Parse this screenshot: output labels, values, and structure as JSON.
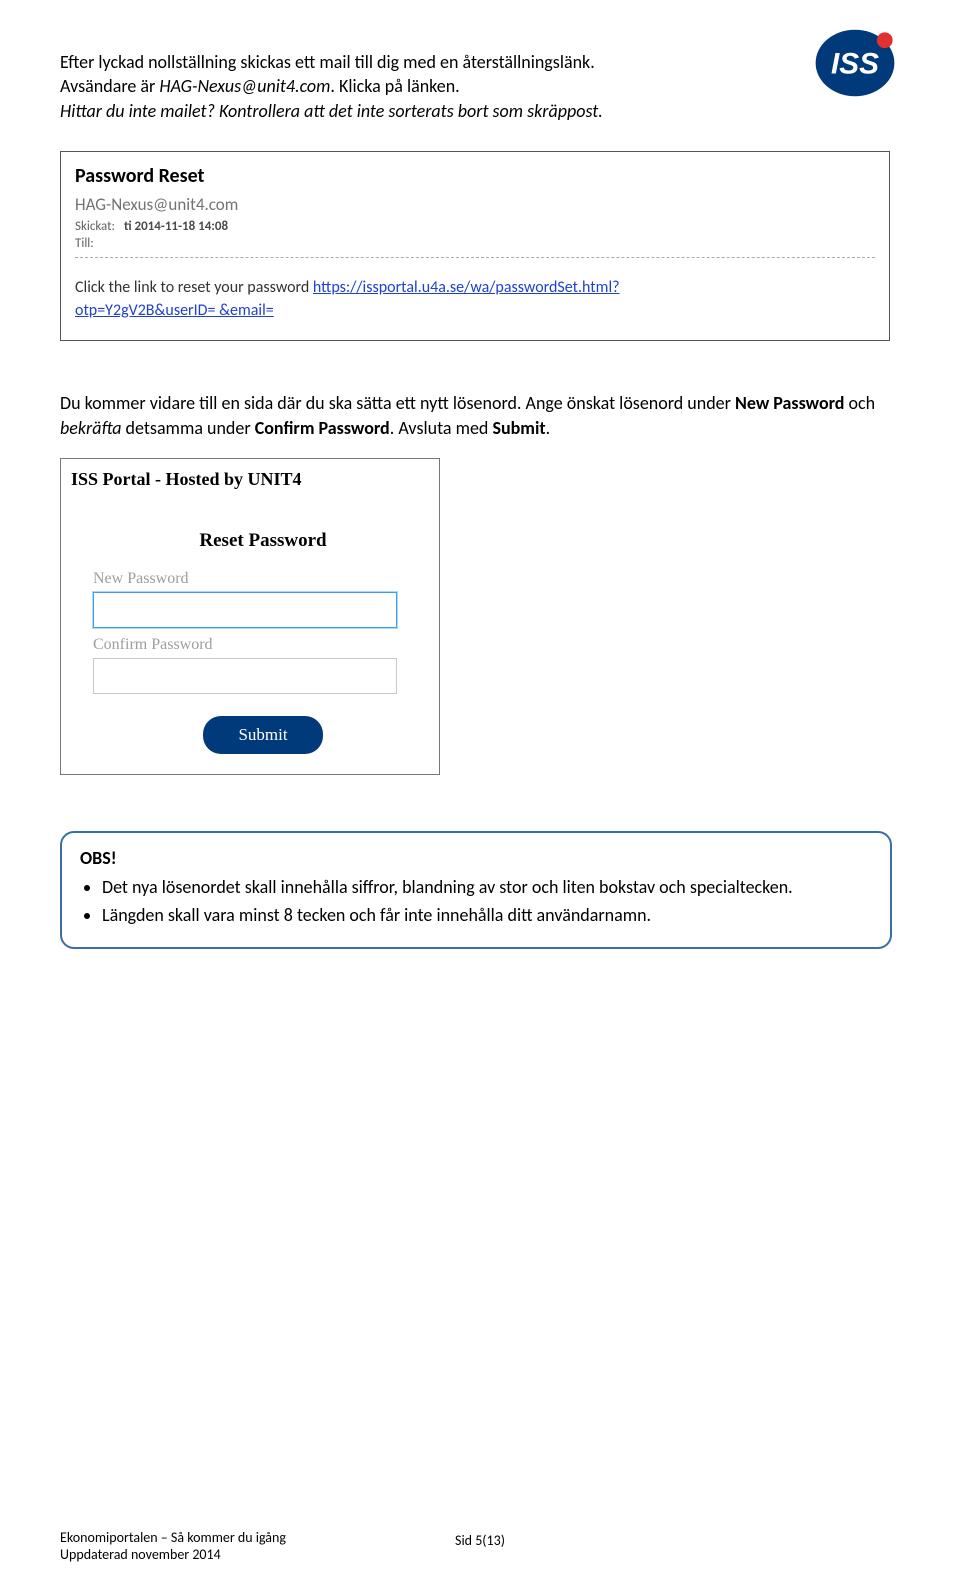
{
  "logo": {
    "text": "ISS",
    "bg": "#003a7a",
    "accent": "#e03030"
  },
  "intro": {
    "line1": "Efter lyckad nollställning skickas ett mail till dig med en återställningslänk.",
    "line2a": "Avsändare är ",
    "line2_email": "HAG-Nexus@unit4.com",
    "line2b": ". Klicka på länken.",
    "line3": "Hittar du inte mailet? Kontrollera att det inte sorterats bort som skräppost."
  },
  "email": {
    "title": "Password Reset",
    "from": "HAG-Nexus@unit4.com",
    "sent_label": "Skickat:",
    "sent_value": "ti 2014-11-18 14:08",
    "to_label": "Till:",
    "body_prefix": "Click the link to reset your password ",
    "link1": "https://issportal.u4a.se/wa/passwordSet.html?",
    "link2": "otp=Y2gV2B&userID=         &email=    "
  },
  "mid": {
    "p1a": "Du kommer vidare till en sida där du ska sätta ett nytt lösenord. Ange önskat lösenord under ",
    "np": "New Password",
    "p1b": " och ",
    "bek": "bekräfta",
    "p1c": " detsamma under ",
    "cp": "Confirm Password",
    "p1d": ". Avsluta med ",
    "sub": "Submit",
    "p1e": "."
  },
  "form": {
    "header": "ISS Portal - Hosted by UNIT4",
    "subheader": "Reset Password",
    "new_pw_label": "New Password",
    "confirm_pw_label": "Confirm Password",
    "submit_label": "Submit"
  },
  "obs": {
    "title": "OBS!",
    "items": [
      "Det nya lösenordet skall innehålla siffror, blandning av stor och liten bokstav och specialtecken.",
      "Längden skall vara minst 8 tecken och får inte innehålla ditt användarnamn."
    ]
  },
  "footer": {
    "left1": "Ekonomiportalen – Så kommer du igång",
    "left2": "Uppdaterad november 2014",
    "page": "Sid 5(13)"
  }
}
